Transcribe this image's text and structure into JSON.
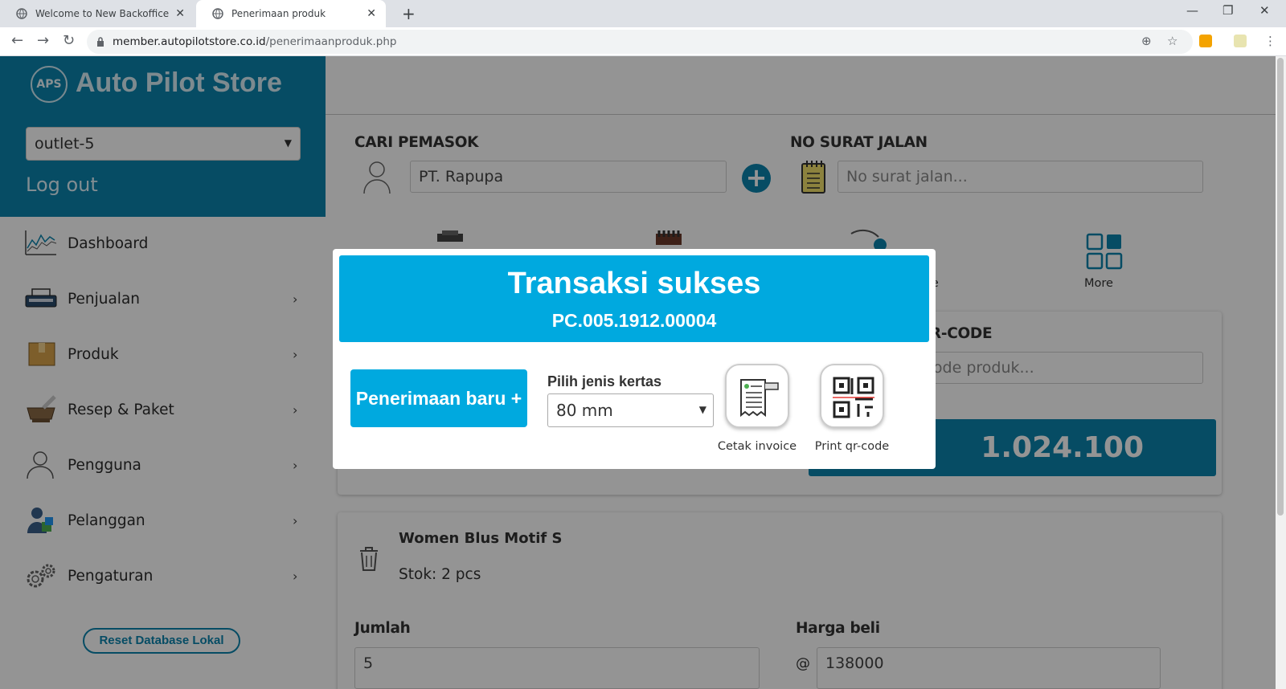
{
  "browser": {
    "tabs": [
      {
        "title": "Welcome to New Backoffice",
        "active": false
      },
      {
        "title": "Penerimaan produk",
        "active": true
      }
    ],
    "url_host": "member.autopilotstore.co.id",
    "url_path": "/penerimaanproduk.php"
  },
  "sidebar": {
    "brand": "Auto Pilot Store",
    "logo_text": "APS",
    "outlet": "outlet-5",
    "logout": "Log out",
    "items": [
      {
        "label": "Dashboard",
        "icon": "chart-icon",
        "has_submenu": false
      },
      {
        "label": "Penjualan",
        "icon": "printer-icon",
        "has_submenu": true
      },
      {
        "label": "Produk",
        "icon": "box-icon",
        "has_submenu": true
      },
      {
        "label": "Resep & Paket",
        "icon": "mortar-icon",
        "has_submenu": true
      },
      {
        "label": "Pengguna",
        "icon": "user-icon",
        "has_submenu": true
      },
      {
        "label": "Pelanggan",
        "icon": "customer-icon",
        "has_submenu": true
      },
      {
        "label": "Pengaturan",
        "icon": "gear-icon",
        "has_submenu": true
      }
    ],
    "reset_button": "Reset Database Lokal"
  },
  "main": {
    "supplier_label": "CARI PEMASOK",
    "supplier_value": "PT. Rapupa",
    "delivery_label": "NO SURAT JALAN",
    "delivery_placeholder": "No surat jalan...",
    "more_label": "More",
    "invoice_partial": "oice",
    "qr_label_partial": "/QR-CODE",
    "qr_placeholder_partial": "r-code produk...",
    "total": "1.024.100",
    "product": {
      "name": "Women Blus Motif S",
      "stock": "Stok: 2 pcs",
      "qty_label": "Jumlah",
      "qty_value": "5",
      "price_label": "Harga beli",
      "price_prefix": "@",
      "price_value": "138000"
    }
  },
  "modal": {
    "title": "Transaksi sukses",
    "code": "PC.005.1912.00004",
    "new_button": "Penerimaan baru +",
    "paper_label": "Pilih jenis kertas",
    "paper_value": "80 mm",
    "print_invoice": "Cetak invoice",
    "print_qr": "Print qr-code"
  },
  "colors": {
    "brand": "#0b83ad",
    "accent": "#00a9df"
  }
}
